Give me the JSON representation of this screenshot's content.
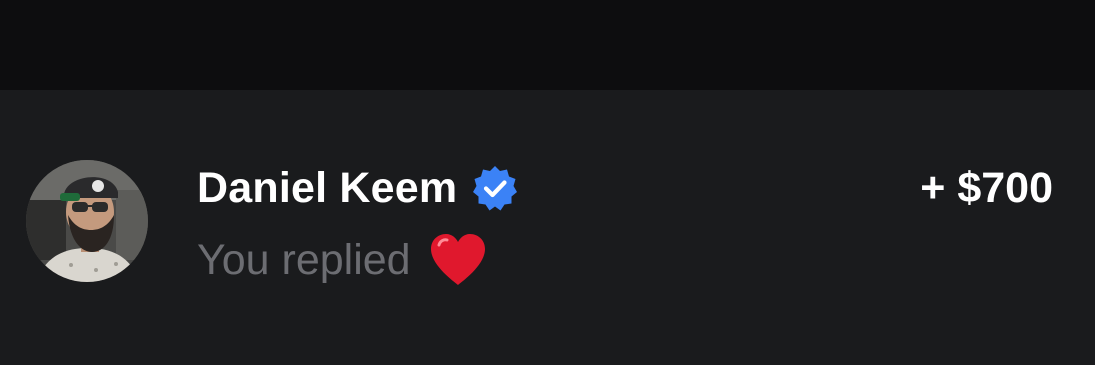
{
  "transaction": {
    "name": "Daniel Keem",
    "subtitle": "You replied",
    "amount": "+ $700",
    "verified": true,
    "reaction_icon": "red-heart",
    "verified_icon": "verified-badge-icon"
  },
  "colors": {
    "top_band": "#0d0d0f",
    "background": "#1a1b1d",
    "name_text": "#ffffff",
    "subtitle_text": "#6c6d72",
    "verified_badge": "#3b82f6",
    "heart": "#e0182d"
  }
}
